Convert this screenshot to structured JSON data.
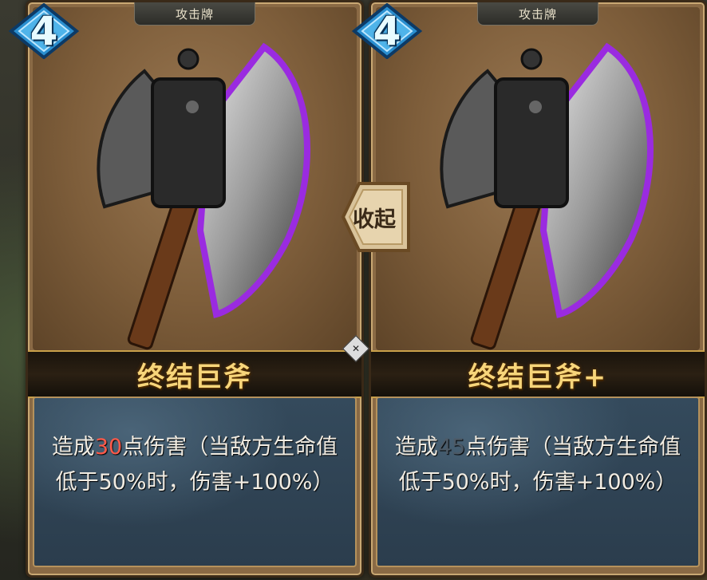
{
  "cards": [
    {
      "cost": "4",
      "type_label": "攻击牌",
      "name": "终结巨斧",
      "desc_pre": "造成",
      "damage": "30",
      "desc_post": "点伤害（当敌方生命值低于50%时，伤害+100%）"
    },
    {
      "cost": "4",
      "type_label": "攻击牌",
      "name": "终结巨斧+",
      "desc_pre": "造成",
      "damage": "45",
      "desc_post": "点伤害（当敌方生命值低于50%时，伤害+100%）"
    }
  ],
  "collapse_button": {
    "label": "收起"
  },
  "colors": {
    "cost_gem": "#2a8fd0",
    "name_gold": "#f7d57a",
    "damage_highlight": "#ff5a4a",
    "desc_panel": "#344a5c"
  },
  "icons": [
    "battle-axe-icon",
    "cost-gem-icon",
    "expand-card-icon"
  ]
}
